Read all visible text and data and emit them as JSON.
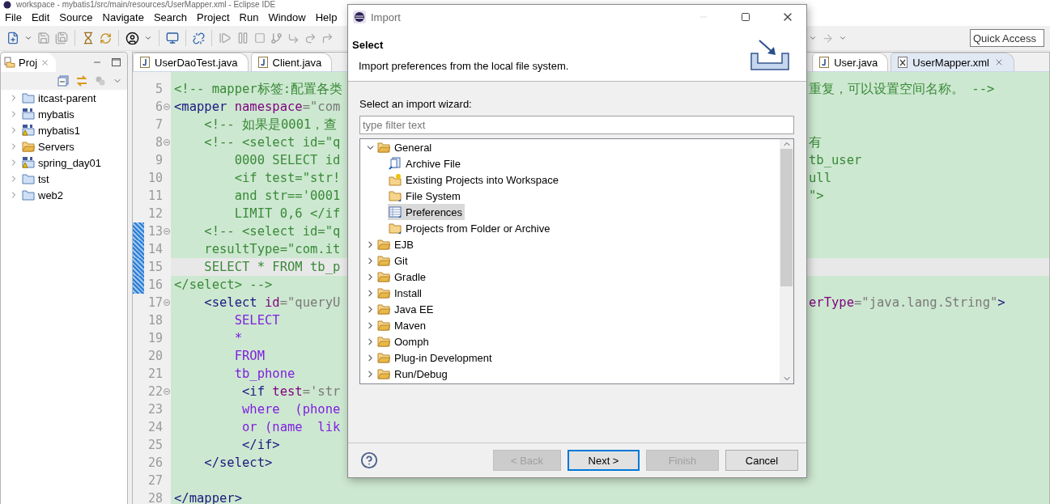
{
  "window": {
    "title": "workspace - mybatis1/src/main/resources/UserMapper.xml - Eclipse IDE"
  },
  "menu": [
    "File",
    "Edit",
    "Source",
    "Navigate",
    "Search",
    "Project",
    "Run",
    "Window",
    "Help"
  ],
  "quick_access": {
    "placeholder": "Quick Access"
  },
  "project_explorer": {
    "tab": "Proj",
    "items": [
      {
        "label": "itcast-parent",
        "kind": "project",
        "warning": false,
        "expanded": false
      },
      {
        "label": "mybatis",
        "kind": "maven",
        "warning": false,
        "expanded": false
      },
      {
        "label": "mybatis1",
        "kind": "maven",
        "warning": true,
        "expanded": false
      },
      {
        "label": "Servers",
        "kind": "folder",
        "warning": false,
        "expanded": false
      },
      {
        "label": "spring_day01",
        "kind": "maven",
        "warning": true,
        "expanded": false
      },
      {
        "label": "tst",
        "kind": "project",
        "warning": false,
        "expanded": false
      },
      {
        "label": "web2",
        "kind": "project",
        "warning": false,
        "expanded": false
      }
    ]
  },
  "editor": {
    "tab_groups": [
      {
        "tabs": [
          {
            "label": "UserDaoTest.java",
            "kind": "java",
            "selected": false
          },
          {
            "label": "Client.java",
            "kind": "java",
            "selected": false
          }
        ]
      },
      {
        "tabs": [
          {
            "label": "User.java",
            "kind": "java",
            "selected": false
          },
          {
            "label": "UserMapper.xml",
            "kind": "xml",
            "selected": true
          }
        ]
      }
    ],
    "lines": [
      {
        "number": "5",
        "fold": false,
        "changed": false,
        "current": false,
        "left": [
          {
            "kind": "comment",
            "text": "<!-- mapper标签:配置各类"
          }
        ],
        "right": [
          {
            "kind": "comment",
            "text": "重复，可以设置空间名称。 -->"
          }
        ]
      },
      {
        "number": "6",
        "fold": true,
        "changed": false,
        "current": false,
        "left": [
          {
            "kind": "tag",
            "text": "<mapper"
          },
          {
            "kind": "attr",
            "text": " namespace"
          },
          {
            "kind": "string",
            "text": "=\"com"
          }
        ]
      },
      {
        "number": "7",
        "fold": false,
        "changed": false,
        "current": false,
        "left": [
          {
            "kind": "comment",
            "text": "    <!-- 如果是0001，查"
          }
        ]
      },
      {
        "number": "8",
        "fold": true,
        "changed": false,
        "current": false,
        "left": [
          {
            "kind": "comment",
            "text": "    <!-- <select id=\"q"
          }
        ],
        "right": [
          {
            "kind": "comment",
            "text": "有"
          }
        ]
      },
      {
        "number": "9",
        "fold": false,
        "changed": false,
        "current": false,
        "left": [
          {
            "kind": "comment",
            "text": "        0000 SELECT id"
          }
        ],
        "right": [
          {
            "kind": "comment",
            "text": "tb_user"
          }
        ]
      },
      {
        "number": "10",
        "fold": false,
        "changed": false,
        "current": false,
        "left": [
          {
            "kind": "comment",
            "text": "        <if test=\"str!"
          }
        ],
        "right": [
          {
            "kind": "comment",
            "text": "ull"
          }
        ]
      },
      {
        "number": "11",
        "fold": false,
        "changed": false,
        "current": false,
        "left": [
          {
            "kind": "comment",
            "text": "        and str=='0001"
          }
        ],
        "right": [
          {
            "kind": "comment",
            "text": "\">"
          }
        ]
      },
      {
        "number": "12",
        "fold": false,
        "changed": false,
        "current": false,
        "left": [
          {
            "kind": "comment",
            "text": "        LIMIT 0,6 </if"
          }
        ]
      },
      {
        "number": "13",
        "fold": true,
        "changed": true,
        "current": false,
        "left": [
          {
            "kind": "comment",
            "text": "    <!-- <select id=\"q"
          }
        ]
      },
      {
        "number": "14",
        "fold": false,
        "changed": true,
        "current": false,
        "left": [
          {
            "kind": "comment",
            "text": "    resultType=\"com.it"
          }
        ]
      },
      {
        "number": "15",
        "fold": false,
        "changed": true,
        "current": true,
        "left": [
          {
            "kind": "comment",
            "text": "    SELECT * FROM tb_p"
          }
        ]
      },
      {
        "number": "16",
        "fold": false,
        "changed": true,
        "current": false,
        "left": [
          {
            "kind": "comment",
            "text": "</select> -->"
          }
        ]
      },
      {
        "number": "17",
        "fold": true,
        "changed": false,
        "current": false,
        "left": [
          {
            "kind": "tag",
            "text": "    <select"
          },
          {
            "kind": "attr",
            "text": " id"
          },
          {
            "kind": "string",
            "text": "=\"queryU"
          }
        ],
        "right": [
          {
            "kind": "attr",
            "text": "erType"
          },
          {
            "kind": "string",
            "text": "=\"java.lang.String\""
          },
          {
            "kind": "tag",
            "text": ">"
          }
        ]
      },
      {
        "number": "18",
        "fold": false,
        "changed": false,
        "current": false,
        "left": [
          {
            "kind": "text",
            "text": "        SELECT"
          }
        ]
      },
      {
        "number": "19",
        "fold": false,
        "changed": false,
        "current": false,
        "left": [
          {
            "kind": "text",
            "text": "        *"
          }
        ]
      },
      {
        "number": "20",
        "fold": false,
        "changed": false,
        "current": false,
        "left": [
          {
            "kind": "text",
            "text": "        FROM"
          }
        ]
      },
      {
        "number": "21",
        "fold": false,
        "changed": false,
        "current": false,
        "left": [
          {
            "kind": "text",
            "text": "        tb_phone"
          }
        ]
      },
      {
        "number": "22",
        "fold": true,
        "changed": false,
        "current": false,
        "left": [
          {
            "kind": "tag",
            "text": "         <if"
          },
          {
            "kind": "attr",
            "text": " test"
          },
          {
            "kind": "string",
            "text": "='str"
          }
        ]
      },
      {
        "number": "23",
        "fold": false,
        "changed": false,
        "current": false,
        "left": [
          {
            "kind": "text",
            "text": "         where  (phone"
          }
        ]
      },
      {
        "number": "24",
        "fold": false,
        "changed": false,
        "current": false,
        "left": [
          {
            "kind": "text",
            "text": "         or (name  lik"
          }
        ]
      },
      {
        "number": "25",
        "fold": false,
        "changed": false,
        "current": false,
        "left": [
          {
            "kind": "tag",
            "text": "         </if>"
          }
        ]
      },
      {
        "number": "26",
        "fold": false,
        "changed": false,
        "current": false,
        "left": [
          {
            "kind": "tag",
            "text": "    </select>"
          }
        ]
      },
      {
        "number": "27",
        "fold": false,
        "changed": false,
        "current": false
      },
      {
        "number": "28",
        "fold": false,
        "changed": false,
        "current": false,
        "left": [
          {
            "kind": "tag",
            "text": "</mapper>"
          }
        ]
      }
    ]
  },
  "dialog": {
    "title": "Import",
    "heading": "Select",
    "description": "Import preferences from the local file system.",
    "filter_label": "Select an import wizard:",
    "filter": {
      "placeholder": "type filter text"
    },
    "wizard_tree": [
      {
        "label": "General",
        "expanded": true,
        "selected": false,
        "children": [
          {
            "label": "Archive File",
            "kind": "archive",
            "selected": false
          },
          {
            "label": "Existing Projects into Workspace",
            "kind": "projects",
            "selected": false
          },
          {
            "label": "File System",
            "kind": "folder",
            "selected": false
          },
          {
            "label": "Preferences",
            "kind": "preferences",
            "selected": true
          },
          {
            "label": "Projects from Folder or Archive",
            "kind": "folder",
            "selected": false
          }
        ]
      },
      {
        "label": "EJB",
        "expanded": false,
        "selected": false
      },
      {
        "label": "Git",
        "expanded": false,
        "selected": false
      },
      {
        "label": "Gradle",
        "expanded": false,
        "selected": false
      },
      {
        "label": "Install",
        "expanded": false,
        "selected": false
      },
      {
        "label": "Java EE",
        "expanded": false,
        "selected": false
      },
      {
        "label": "Maven",
        "expanded": false,
        "selected": false
      },
      {
        "label": "Oomph",
        "expanded": false,
        "selected": false
      },
      {
        "label": "Plug-in Development",
        "expanded": false,
        "selected": false
      },
      {
        "label": "Run/Debug",
        "expanded": false,
        "selected": false
      }
    ],
    "buttons": [
      {
        "label": "< Back",
        "disabled": true,
        "default": false
      },
      {
        "label": "Next >",
        "disabled": false,
        "default": true
      },
      {
        "label": "Finish",
        "disabled": true,
        "default": false
      },
      {
        "label": "Cancel",
        "disabled": false,
        "default": false
      }
    ]
  }
}
